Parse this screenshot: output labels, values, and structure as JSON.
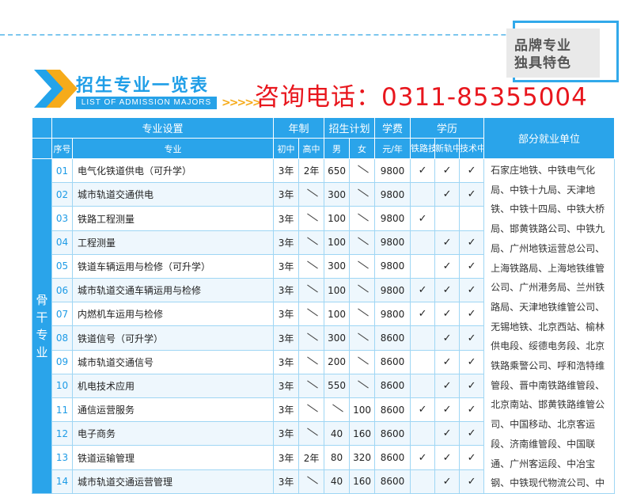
{
  "brand": {
    "line1": "品牌专业",
    "line2": "独具特色"
  },
  "title": "招生专业一览表",
  "subtitle": "LIST OF ADMISSION MAJORS",
  "phone": "咨询电话：0311-85355004",
  "header": {
    "zhuanye": "专业设置",
    "nianzhi": "年制",
    "jihua": "招生计划",
    "xuefei": "学费",
    "xueli": "学历",
    "jobs": "部分就业单位",
    "seq": "序号",
    "major": "专业",
    "chuzhong": "初中",
    "gaozhong": "高中",
    "male": "男",
    "female": "女",
    "fee_unit": "元/年",
    "tielu": "铁路技工",
    "xingui": "新轨中专",
    "jishu": "技术中专"
  },
  "category": "骨干专业",
  "rows": [
    {
      "seq": "01",
      "name": "电气化铁道供电（可升学）",
      "chu": "3年",
      "gao": "2年",
      "male": "650",
      "female": "",
      "fee": "9800",
      "tielu": "✓",
      "xingui": "✓",
      "jishu": "✓"
    },
    {
      "seq": "02",
      "name": "城市轨道交通供电",
      "chu": "3年",
      "gao": "",
      "male": "300",
      "female": "",
      "fee": "9800",
      "tielu": "",
      "xingui": "✓",
      "jishu": "✓"
    },
    {
      "seq": "03",
      "name": "铁路工程测量",
      "chu": "3年",
      "gao": "",
      "male": "100",
      "female": "",
      "fee": "9800",
      "tielu": "✓",
      "xingui": "",
      "jishu": ""
    },
    {
      "seq": "04",
      "name": "工程测量",
      "chu": "3年",
      "gao": "",
      "male": "100",
      "female": "",
      "fee": "9800",
      "tielu": "",
      "xingui": "✓",
      "jishu": "✓"
    },
    {
      "seq": "05",
      "name": "铁道车辆运用与检修（可升学）",
      "chu": "3年",
      "gao": "",
      "male": "300",
      "female": "",
      "fee": "9800",
      "tielu": "",
      "xingui": "✓",
      "jishu": "✓"
    },
    {
      "seq": "06",
      "name": "城市轨道交通车辆运用与检修",
      "chu": "3年",
      "gao": "",
      "male": "100",
      "female": "",
      "fee": "9800",
      "tielu": "✓",
      "xingui": "✓",
      "jishu": "✓"
    },
    {
      "seq": "07",
      "name": "内燃机车运用与检修",
      "chu": "3年",
      "gao": "",
      "male": "100",
      "female": "",
      "fee": "9800",
      "tielu": "✓",
      "xingui": "✓",
      "jishu": "✓"
    },
    {
      "seq": "08",
      "name": "铁道信号（可升学）",
      "chu": "3年",
      "gao": "",
      "male": "300",
      "female": "",
      "fee": "8600",
      "tielu": "",
      "xingui": "✓",
      "jishu": "✓"
    },
    {
      "seq": "09",
      "name": "城市轨道交通信号",
      "chu": "3年",
      "gao": "",
      "male": "200",
      "female": "",
      "fee": "8600",
      "tielu": "",
      "xingui": "✓",
      "jishu": "✓"
    },
    {
      "seq": "10",
      "name": "机电技术应用",
      "chu": "3年",
      "gao": "",
      "male": "550",
      "female": "",
      "fee": "8600",
      "tielu": "",
      "xingui": "✓",
      "jishu": "✓"
    },
    {
      "seq": "11",
      "name": "通信运营服务",
      "chu": "3年",
      "gao": "",
      "male": "",
      "female": "100",
      "fee": "8600",
      "tielu": "✓",
      "xingui": "✓",
      "jishu": "✓"
    },
    {
      "seq": "12",
      "name": "电子商务",
      "chu": "3年",
      "gao": "",
      "male": "40",
      "female": "160",
      "fee": "8600",
      "tielu": "",
      "xingui": "✓",
      "jishu": "✓"
    },
    {
      "seq": "13",
      "name": "铁道运输管理",
      "chu": "3年",
      "gao": "2年",
      "male": "80",
      "female": "320",
      "fee": "8600",
      "tielu": "✓",
      "xingui": "✓",
      "jishu": "✓"
    },
    {
      "seq": "14",
      "name": "城市轨道交通运营管理",
      "chu": "3年",
      "gao": "",
      "male": "40",
      "female": "160",
      "fee": "8600",
      "tielu": "",
      "xingui": "✓",
      "jishu": "✓"
    }
  ],
  "jobs_text": "石家庄地铁、中铁电气化局、中铁十九局、天津地铁、中铁十四局、中铁大桥局、邯黄铁路公司、中铁九局、广州地铁运营总公司、上海铁路局、上海地铁维管公司、广州港务局、兰州铁路局、天津地铁维管公司、无锡地铁、北京西站、榆林供电段、绥德电务段、北京铁路乘警公司、呼和浩特维管段、晋中南铁路维管段、北京南站、邯黄铁路维管公司、中国移动、北京客运段、济南维管段、中国联通、广州客运段、中冶宝钢、中铁现代物流公司、中"
}
